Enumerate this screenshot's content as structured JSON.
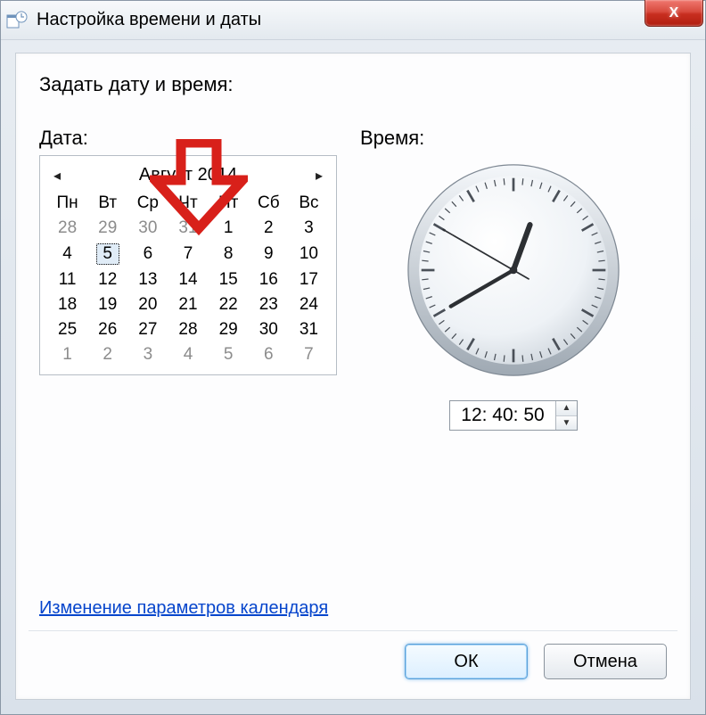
{
  "window": {
    "title": "Настройка времени и даты",
    "close_glyph": "X"
  },
  "heading": "Задать дату и время:",
  "date": {
    "label": "Дата:",
    "month_title": "Август 2014",
    "prev_glyph": "◂",
    "next_glyph": "▸",
    "weekdays": [
      "Пн",
      "Вт",
      "Ср",
      "Чт",
      "Пт",
      "Сб",
      "Вс"
    ],
    "rows": [
      [
        {
          "d": "28",
          "o": true
        },
        {
          "d": "29",
          "o": true
        },
        {
          "d": "30",
          "o": true
        },
        {
          "d": "31",
          "o": true
        },
        {
          "d": "1"
        },
        {
          "d": "2"
        },
        {
          "d": "3"
        }
      ],
      [
        {
          "d": "4"
        },
        {
          "d": "5",
          "sel": true
        },
        {
          "d": "6"
        },
        {
          "d": "7"
        },
        {
          "d": "8"
        },
        {
          "d": "9"
        },
        {
          "d": "10"
        }
      ],
      [
        {
          "d": "11"
        },
        {
          "d": "12"
        },
        {
          "d": "13"
        },
        {
          "d": "14"
        },
        {
          "d": "15"
        },
        {
          "d": "16"
        },
        {
          "d": "17"
        }
      ],
      [
        {
          "d": "18"
        },
        {
          "d": "19"
        },
        {
          "d": "20"
        },
        {
          "d": "21"
        },
        {
          "d": "22"
        },
        {
          "d": "23"
        },
        {
          "d": "24"
        }
      ],
      [
        {
          "d": "25"
        },
        {
          "d": "26"
        },
        {
          "d": "27"
        },
        {
          "d": "28"
        },
        {
          "d": "29"
        },
        {
          "d": "30"
        },
        {
          "d": "31"
        }
      ],
      [
        {
          "d": "1",
          "o": true
        },
        {
          "d": "2",
          "o": true
        },
        {
          "d": "3",
          "o": true
        },
        {
          "d": "4",
          "o": true
        },
        {
          "d": "5",
          "o": true
        },
        {
          "d": "6",
          "o": true
        },
        {
          "d": "7",
          "o": true
        }
      ]
    ]
  },
  "time": {
    "label": "Время:",
    "value": "12: 40: 50",
    "hours": 12,
    "minutes": 40,
    "seconds": 50,
    "spin_up": "▲",
    "spin_down": "▼"
  },
  "link": "Изменение параметров календаря",
  "buttons": {
    "ok": "ОК",
    "cancel": "Отмена"
  },
  "colors": {
    "accent_red": "#d8201a",
    "link_blue": "#0645cc"
  }
}
